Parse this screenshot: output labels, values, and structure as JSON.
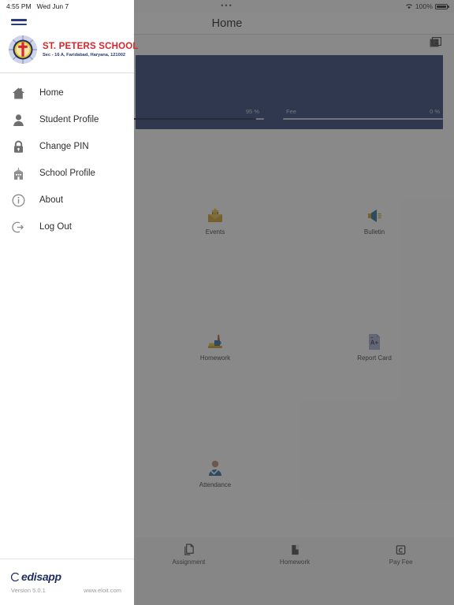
{
  "status_bar": {
    "time": "4:55 PM",
    "date": "Wed Jun 7",
    "dots": "•••",
    "battery_percent": "100%",
    "wifi_icon": "wifi-icon",
    "battery_icon": "battery-icon"
  },
  "navbar": {
    "title": "Home",
    "card_icon": "id-card-icon"
  },
  "banner": {
    "attendance_bar": {
      "label": "",
      "value_text": "95 %",
      "percent": 95
    },
    "fee_bar": {
      "label": "Fee",
      "value_text": "0 %",
      "percent": 0
    },
    "color": "#1e3368"
  },
  "app_grid": [
    {
      "label": "Events",
      "icon": "events-envelope-icon"
    },
    {
      "label": "Bulletin",
      "icon": "bulletin-megaphone-icon"
    },
    {
      "label": "Homework",
      "icon": "homework-books-icon"
    },
    {
      "label": "Report Card",
      "icon": "report-card-document-icon"
    },
    {
      "label": "Attendance",
      "icon": "attendance-person-check-icon"
    }
  ],
  "bottom_nav": [
    {
      "label": "Assignment",
      "icon": "assignment-document-icon"
    },
    {
      "label": "Homework",
      "icon": "homework-book-icon"
    },
    {
      "label": "Pay Fee",
      "icon": "pay-fee-card-icon"
    }
  ],
  "sidebar": {
    "menu_icon": "hamburger-menu-icon",
    "school": {
      "name": "ST. PETERS SCHOOL",
      "address": "Sec - 16 A, Faridabad, Haryana, 121002",
      "logo_icon": "school-crest-icon",
      "name_color": "#d8262c",
      "address_color": "#2b3a7a"
    },
    "items": [
      {
        "label": "Home",
        "icon": "home-icon"
      },
      {
        "label": "Student Profile",
        "icon": "person-icon"
      },
      {
        "label": "Change PIN",
        "icon": "lock-icon"
      },
      {
        "label": "School Profile",
        "icon": "building-icon"
      },
      {
        "label": "About",
        "icon": "info-circle-icon"
      },
      {
        "label": "Log Out",
        "icon": "logout-arrow-icon"
      }
    ],
    "footer": {
      "brand": "edisapp",
      "version": "Version 5.0.1",
      "website": "www.eloit.com"
    }
  }
}
